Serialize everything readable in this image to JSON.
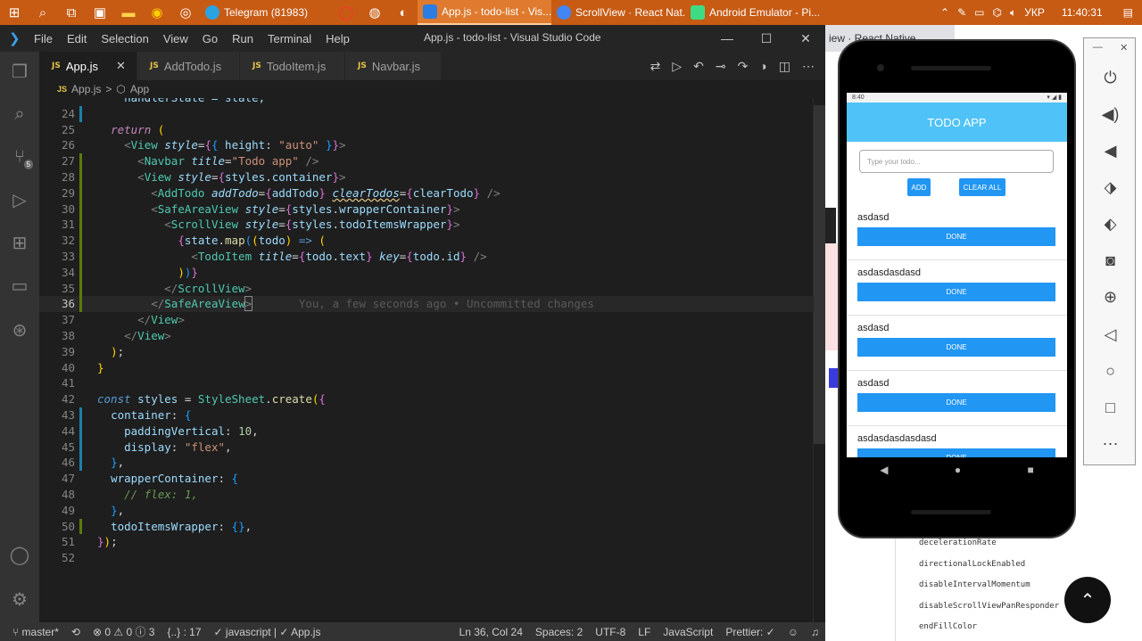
{
  "taskbar": {
    "tasks": [
      {
        "label": "Telegram (81983)",
        "color": "#2aa3e0",
        "active": false
      },
      {
        "label": "App.js - todo-list - Vis...",
        "color": "#2b7de1",
        "active": true
      },
      {
        "label": "ScrollView · React Nat...",
        "color": "#4285f4",
        "active": false
      },
      {
        "label": "Android Emulator - Pi...",
        "color": "#3ddc84",
        "active": false
      }
    ],
    "language": "УКР",
    "clock": "11:40:31"
  },
  "window": {
    "menu": [
      "File",
      "Edit",
      "Selection",
      "View",
      "Go",
      "Run",
      "Terminal",
      "Help"
    ],
    "title": "App.js - todo-list - Visual Studio Code"
  },
  "tabs": [
    {
      "icon": "JS",
      "label": "App.js",
      "active": true
    },
    {
      "icon": "JS",
      "label": "AddTodo.js",
      "active": false
    },
    {
      "icon": "JS",
      "label": "TodoItem.js",
      "active": false
    },
    {
      "icon": "JS",
      "label": "Navbar.js",
      "active": false
    }
  ],
  "breadcrumb": {
    "icon": "JS",
    "file": "App.js",
    "sep": ">",
    "symbol": "App"
  },
  "source_control_badge": "5",
  "editor": {
    "first_line_fragment": "    handlerState = state;",
    "line_numbers": [
      "24",
      "25",
      "26",
      "27",
      "28",
      "29",
      "30",
      "31",
      "32",
      "33",
      "34",
      "35",
      "36",
      "37",
      "38",
      "39",
      "40",
      "41",
      "42",
      "43",
      "44",
      "45",
      "46",
      "47",
      "48",
      "49",
      "50",
      "51",
      "52"
    ],
    "blame": "You, a few seconds ago • Uncommitted changes"
  },
  "statusbar": {
    "branch": "master*",
    "problems": "⊗ 0 ⚠ 0 ⓘ 3",
    "symbol": "{..} : 17",
    "lang_check": "✓ javascript | ✓ App.js",
    "cursor": "Ln 36, Col 24",
    "spaces": "Spaces: 2",
    "encoding": "UTF-8",
    "eol": "LF",
    "language": "JavaScript",
    "prettier": "Prettier: ✓"
  },
  "browser": {
    "tab_label": "iew · React Native",
    "doc_items": [
      "decelerationRate",
      "directionalLockEnabled",
      "disableIntervalMomentum",
      "disableScrollViewPanResponder",
      "endFillColor"
    ]
  },
  "emulator": {
    "time": "8:40",
    "app_title": "TODO APP",
    "input_placeholder": "Type your todo...",
    "add_label": "ADD",
    "clear_label": "CLEAR ALL",
    "done_label": "DONE",
    "todos": [
      "asdasd",
      "asdasdasdasd",
      "asdasd",
      "asdasd",
      "asdasdasdasdasd"
    ]
  }
}
